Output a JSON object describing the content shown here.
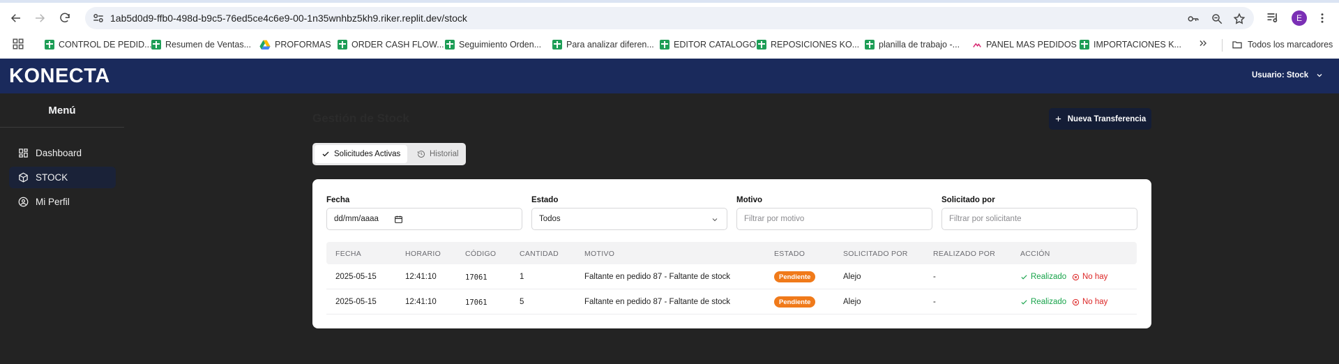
{
  "browser": {
    "url": "1ab5d0d9-ffb0-498d-b9c5-76ed5ce4c6e9-00-1n35wnhbz5kh9.riker.replit.dev/stock",
    "profile_initial": "E",
    "bookmarks": [
      "CONTROL DE PEDID...",
      "Resumen de Ventas...",
      "PROFORMAS",
      "ORDER CASH FLOW...",
      "Seguimiento Orden...",
      "Para analizar diferen...",
      "EDITOR CATALOGO",
      "REPOSICIONES KO...",
      "planilla de trabajo -...",
      "PANEL MAS PEDIDOS",
      "IMPORTACIONES K..."
    ],
    "all_bookmarks": "Todos los marcadores"
  },
  "app": {
    "brand": "KONECTA",
    "user_label": "Usuario: Stock"
  },
  "sidebar": {
    "title": "Menú",
    "items": [
      {
        "label": "Dashboard",
        "icon": "grid-icon"
      },
      {
        "label": "STOCK",
        "icon": "box-icon",
        "active": true
      },
      {
        "label": "Mi Perfil",
        "icon": "user-circle-icon"
      }
    ]
  },
  "main": {
    "title": "Gestión de Stock",
    "new_transfer": "Nueva Transferencia",
    "tabs": [
      {
        "label": "Solicitudes Activas",
        "active": true
      },
      {
        "label": "Historial",
        "active": false
      }
    ],
    "filters": {
      "fecha": {
        "label": "Fecha",
        "value": "dd/mm/aaaa"
      },
      "estado": {
        "label": "Estado",
        "value": "Todos"
      },
      "motivo": {
        "label": "Motivo",
        "placeholder": "Filtrar por motivo"
      },
      "solicitado": {
        "label": "Solicitado por",
        "placeholder": "Filtrar por solicitante"
      }
    },
    "table": {
      "headers": [
        "FECHA",
        "HORARIO",
        "CÓDIGO",
        "CANTIDAD",
        "MOTIVO",
        "ESTADO",
        "SOLICITADO POR",
        "REALIZADO POR",
        "ACCIÓN"
      ],
      "rows": [
        {
          "fecha": "2025-05-15",
          "horario": "12:41:10",
          "codigo": "17061",
          "cantidad": "1",
          "motivo": "Faltante en pedido 87 - Faltante de stock",
          "estado": "Pendiente",
          "solicitado": "Alejo",
          "realizado": "-",
          "accion_ok": "Realizado",
          "accion_no": "No hay"
        },
        {
          "fecha": "2025-05-15",
          "horario": "12:41:10",
          "codigo": "17061",
          "cantidad": "5",
          "motivo": "Faltante en pedido 87 - Faltante de stock",
          "estado": "Pendiente",
          "solicitado": "Alejo",
          "realizado": "-",
          "accion_ok": "Realizado",
          "accion_no": "No hay"
        }
      ]
    }
  },
  "colors": {
    "header": "#1a2a5c",
    "background": "#232323",
    "badge_pending": "#f07a1a",
    "action_ok": "#17a34a",
    "action_no": "#dc2626"
  }
}
